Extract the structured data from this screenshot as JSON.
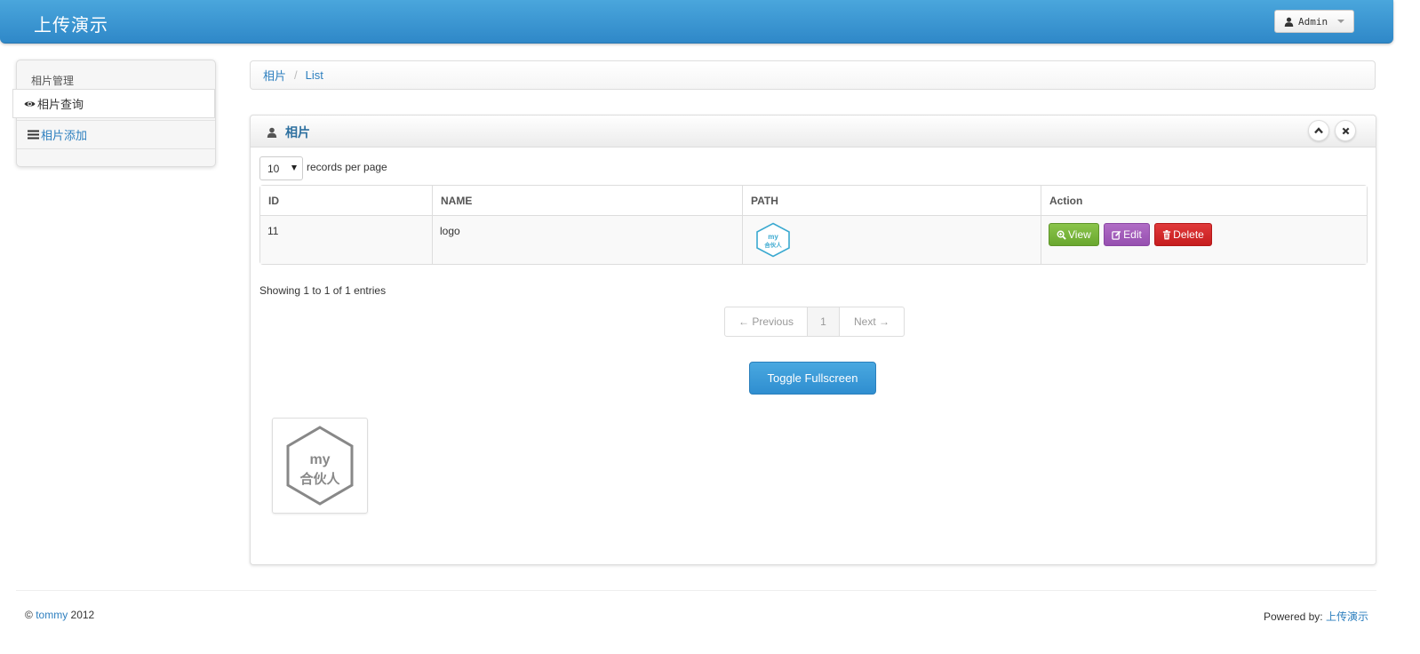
{
  "navbar": {
    "brand": "上传演示",
    "user_label": "Admin",
    "user_icon": "user-icon"
  },
  "sidebar": {
    "header": "相片管理",
    "items": [
      {
        "label": "相片查询",
        "icon": "eye-icon",
        "active": true
      },
      {
        "label": "相片添加",
        "icon": "list-icon",
        "active": false
      }
    ]
  },
  "breadcrumb": {
    "items": [
      "相片",
      "List"
    ],
    "separator": "/"
  },
  "panel": {
    "title": "相片",
    "title_icon": "user-icon",
    "collapse_icon": "chevron-up-icon",
    "close_icon": "close-icon"
  },
  "table": {
    "length_value": "10",
    "length_label": "records per page",
    "columns": [
      "ID",
      "NAME",
      "PATH",
      "Action"
    ],
    "rows": [
      {
        "id": "11",
        "name": "logo",
        "path_image_text": [
          "my",
          "合伙人"
        ]
      }
    ],
    "actions": {
      "view": "View",
      "edit": "Edit",
      "delete": "Delete"
    }
  },
  "pagination": {
    "info": "Showing 1 to 1 of 1 entries",
    "previous": "← Previous",
    "current": "1",
    "next": "Next →"
  },
  "toggle_button": "Toggle Fullscreen",
  "thumbnail": {
    "text": [
      "my",
      "合伙人"
    ]
  },
  "footer": {
    "copyright_symbol": "©",
    "author": "tommy",
    "year": "2012",
    "powered_label": "Powered by:",
    "powered_link": "上传演示"
  },
  "colors": {
    "navbar": "#3a97d4",
    "link": "#2d7fbf",
    "view": "#76b23a",
    "edit": "#a35dbb",
    "delete": "#d22a2b",
    "logo_small": "#3aa9d0",
    "logo_large": "#888888"
  }
}
